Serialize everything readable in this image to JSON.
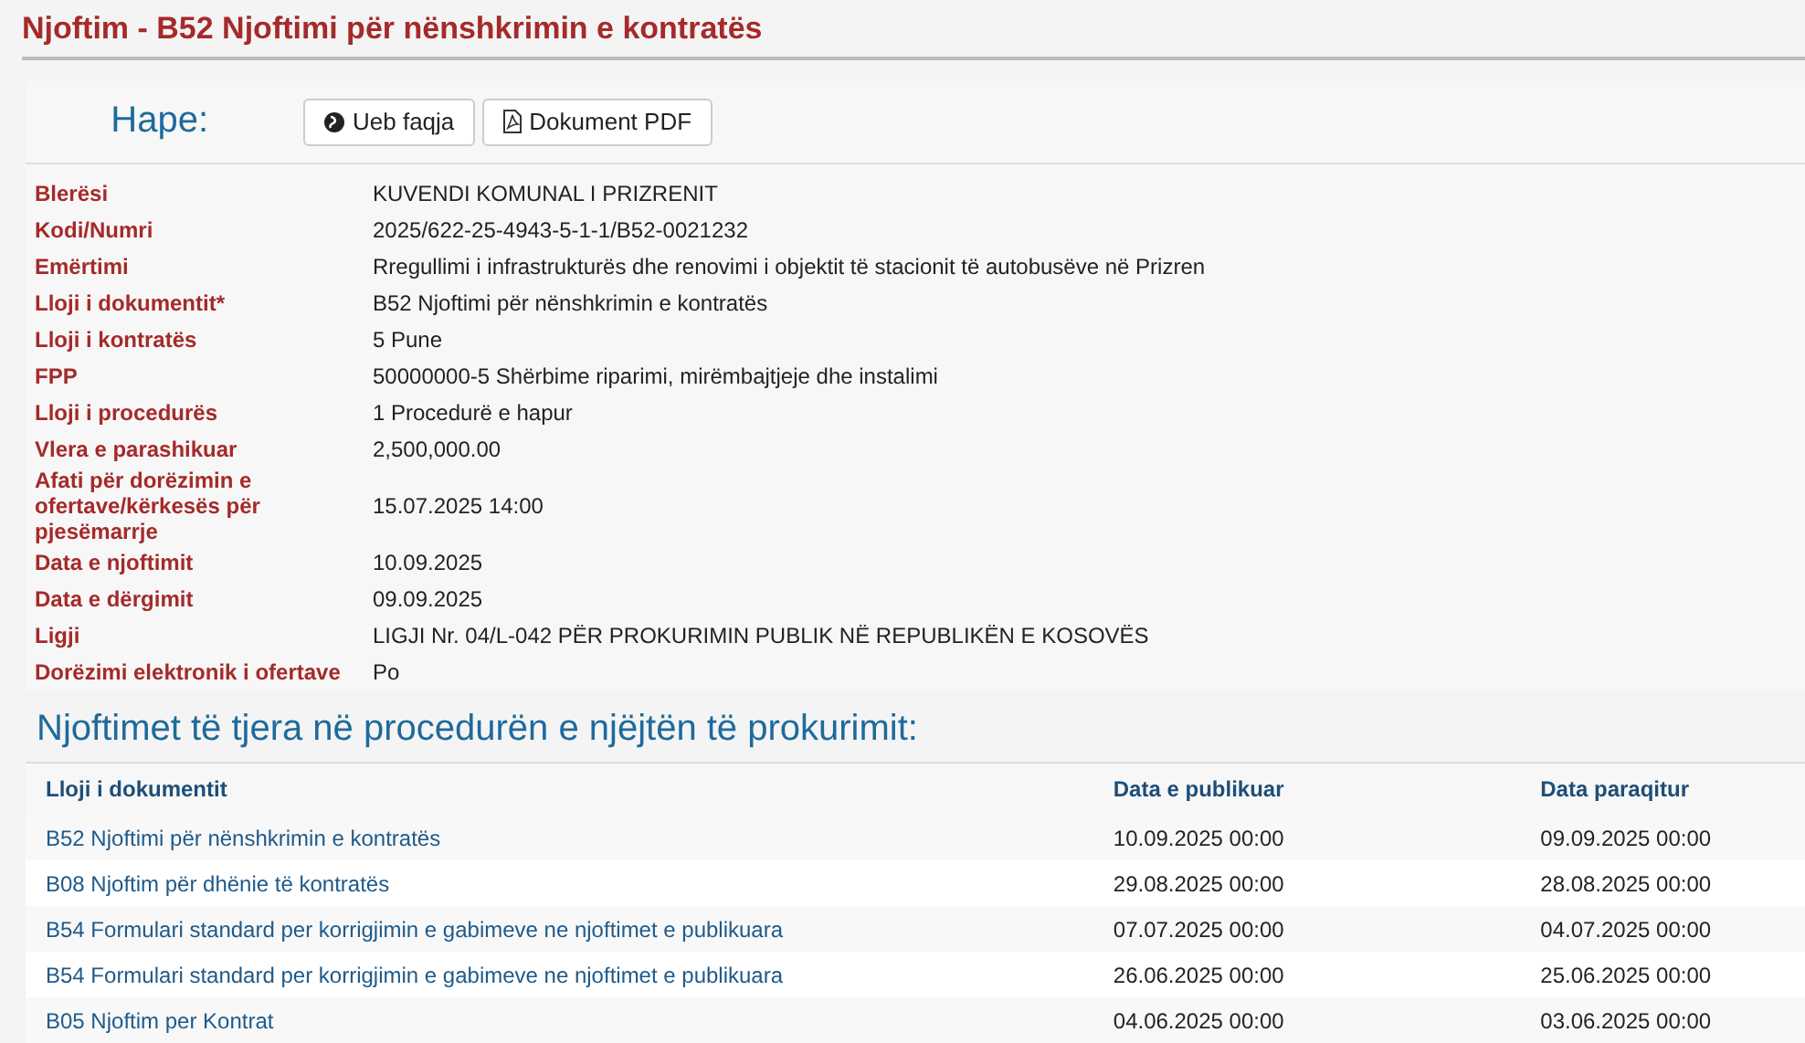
{
  "title": "Njoftim - B52 Njoftimi për nënshkrimin e kontratës",
  "open": {
    "label": "Hape:",
    "buttons": [
      {
        "label": "Ueb faqja",
        "kind": "web"
      },
      {
        "label": "Dokument PDF",
        "kind": "pdf"
      }
    ]
  },
  "details": [
    {
      "label": "Blerësi",
      "value": "KUVENDI KOMUNAL I PRIZRENIT"
    },
    {
      "label": "Kodi/Numri",
      "value": "2025/622-25-4943-5-1-1/B52-0021232"
    },
    {
      "label": "Emërtimi",
      "value": "Rregullimi i infrastrukturës dhe renovimi i objektit të stacionit të autobusëve në Prizren"
    },
    {
      "label": "Lloji i dokumentit*",
      "value": "B52 Njoftimi për nënshkrimin e kontratës"
    },
    {
      "label": "Lloji i kontratës",
      "value": "5 Pune"
    },
    {
      "label": "FPP",
      "value": "50000000-5 Shërbime riparimi, mirëmbajtjeje dhe instalimi"
    },
    {
      "label": "Lloji i procedurës",
      "value": "1 Procedurë e hapur"
    },
    {
      "label": "Vlera e parashikuar",
      "value": "2,500,000.00"
    },
    {
      "label": "Afati për dorëzimin e ofertave/kërkesës për pjesëmarrje",
      "value": "15.07.2025 14:00"
    },
    {
      "label": "Data e njoftimit",
      "value": "10.09.2025"
    },
    {
      "label": "Data e dërgimit",
      "value": "09.09.2025"
    },
    {
      "label": "Ligji",
      "value": "LIGJI Nr. 04/L-042 PËR PROKURIMIN PUBLIK NË REPUBLIKËN E KOSOVËS"
    },
    {
      "label": "Dorëzimi elektronik i ofertave",
      "value": "Po"
    }
  ],
  "related": {
    "heading": "Njoftimet të tjera në procedurën e njëjtën të prokurimit:",
    "columns": [
      "Lloji i dokumentit",
      "Data e publikuar",
      "Data paraqitur"
    ],
    "rows": [
      [
        "B52 Njoftimi për nënshkrimin e kontratës",
        "10.09.2025 00:00",
        "09.09.2025 00:00"
      ],
      [
        "B08 Njoftim për dhënie të kontratës",
        "29.08.2025 00:00",
        "28.08.2025 00:00"
      ],
      [
        "B54 Formulari standard per korrigjimin e gabimeve ne njoftimet e publikuara",
        "07.07.2025 00:00",
        "04.07.2025 00:00"
      ],
      [
        "B54 Formulari standard per korrigjimin e gabimeve ne njoftimet e publikuara",
        "26.06.2025 00:00",
        "25.06.2025 00:00"
      ],
      [
        "B05 Njoftim per Kontrat",
        "04.06.2025 00:00",
        "03.06.2025 00:00"
      ]
    ]
  }
}
